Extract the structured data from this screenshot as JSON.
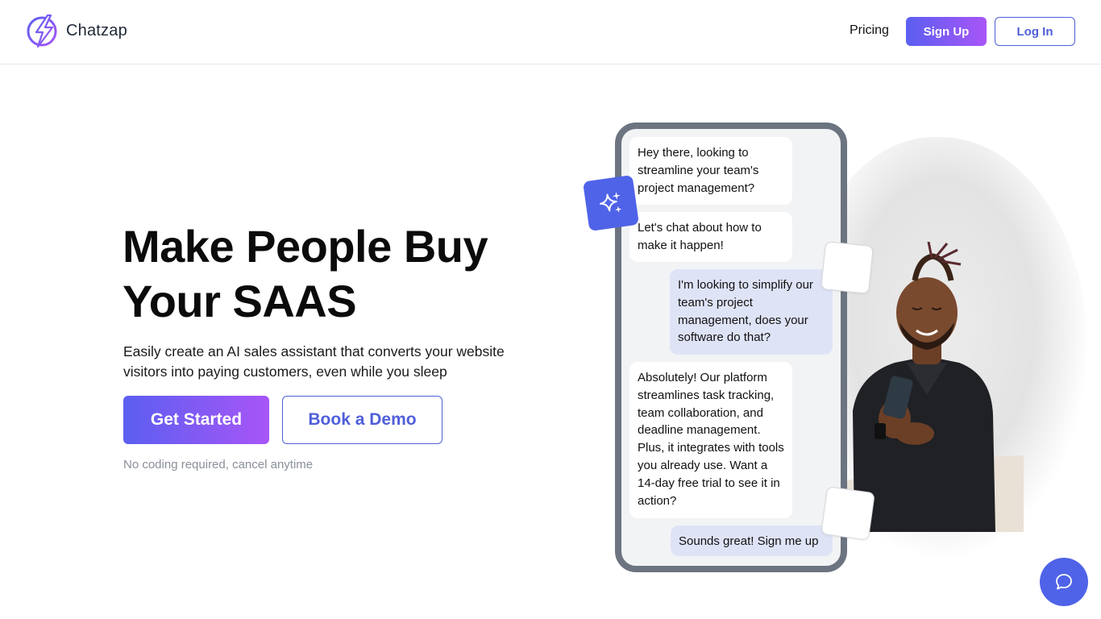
{
  "header": {
    "brand": "Chatzap",
    "nav_pricing": "Pricing",
    "signup_label": "Sign Up",
    "login_label": "Log In"
  },
  "hero": {
    "title_line1": "Make People Buy",
    "title_line2": "Your SAAS",
    "subtitle": "Easily create an AI sales assistant that converts your website visitors into paying customers, even while you sleep",
    "cta_primary": "Get Started",
    "cta_secondary": "Book a Demo",
    "note": "No coding required, cancel anytime"
  },
  "chat": {
    "messages": [
      {
        "role": "bot",
        "text": "Hey there, looking to streamline your team's project management?"
      },
      {
        "role": "bot",
        "text": "Let's chat about how to make it happen!"
      },
      {
        "role": "user",
        "text": "I'm looking to simplify our team's project management, does your software do that?"
      },
      {
        "role": "bot",
        "text": "Absolutely! Our platform streamlines task tracking, team collaboration, and deadline management. Plus, it integrates with tools you already use. Want a 14-day free trial to see it in action?"
      },
      {
        "role": "user",
        "text": "Sounds great! Sign me up"
      }
    ]
  },
  "icons": {
    "logo": "lightning-bolt-logo-icon",
    "sparkle": "sparkle-icon",
    "chat_widget": "chat-bubble-icon"
  },
  "colors": {
    "accent": "#4f5fd9",
    "gradient_start": "#5b5ff0",
    "gradient_end": "#a855f7",
    "phone_frame": "#6b7480",
    "user_bubble": "#dfe3f6"
  }
}
